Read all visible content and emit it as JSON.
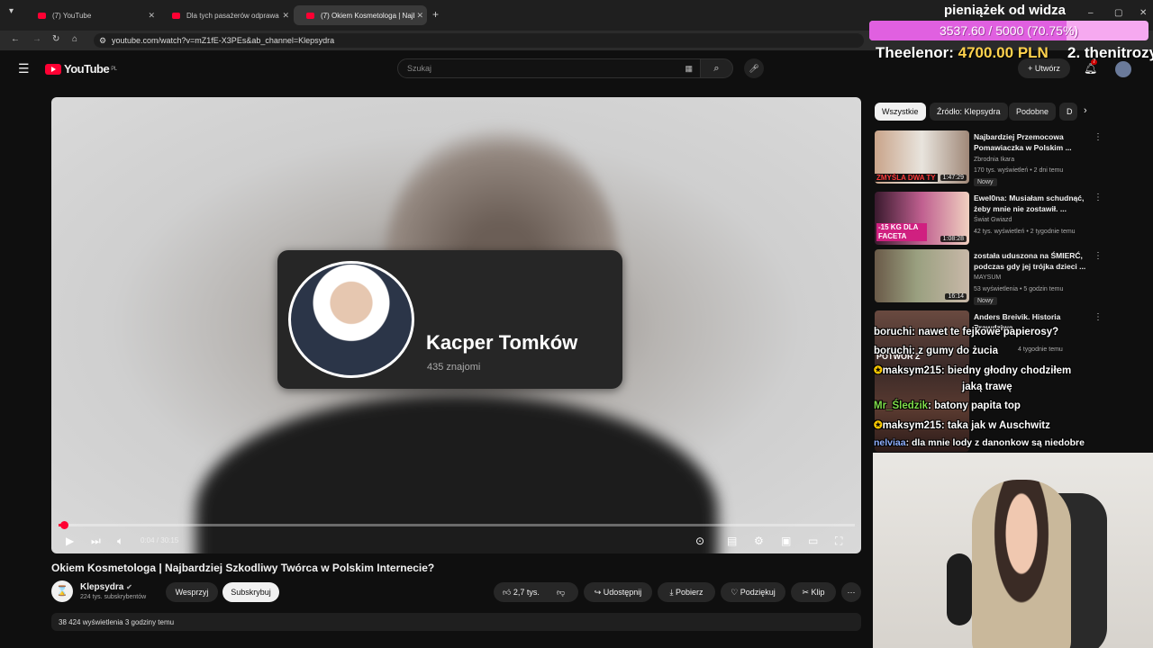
{
  "browser": {
    "tabs": [
      {
        "label": "(7) YouTube",
        "active": false
      },
      {
        "label": "Dla tych pasażerów odprawa s",
        "active": false
      },
      {
        "label": "(7) Okiem Kosmetologa | Najb",
        "active": true
      }
    ],
    "url": "youtube.com/watch?v=mZ1fE-X3PEs&ab_channel=Klepsydra"
  },
  "youtube": {
    "logo_text": "YouTube",
    "logo_region": "PL",
    "search_placeholder": "Szukaj",
    "create_label": "Utwórz",
    "notifications_count": "7"
  },
  "video": {
    "card_name": "Kacper Tomków",
    "card_friends": "435 znajomi",
    "time": "0:04 / 30:15",
    "progress_fraction": 0.0022,
    "title": "Okiem Kosmetologa | Najbardziej Szkodliwy Twórca w Polskim Internecie?",
    "channel_name": "Klepsydra",
    "channel_subs": "224 tys. subskrybentów",
    "support_label": "Wesprzyj",
    "subscribe_label": "Subskrybuj",
    "likes": "2,7 tys.",
    "share_label": "Udostępnij",
    "download_label": "Pobierz",
    "thanks_label": "Podziękuj",
    "clip_label": "Klip",
    "views": "38 424 wyświetlenia  3 godziny temu"
  },
  "sidebar": {
    "chips": [
      "Wszystkie",
      "Źródło: Klepsydra",
      "Podobne",
      "D"
    ],
    "recommendations": [
      {
        "title": "Najbardziej Przemocowa Pomawiaczka w Polskim ...",
        "channel": "Zbrodnia Ikara",
        "meta": "170 tys. wyświetleń • 2 dni temu",
        "duration": "1:47:29",
        "badge": "Nowy",
        "thumb_text": "ZMYŚLA DWA TY"
      },
      {
        "title": "Ewel0na: Musiałam schudnąć, żeby mnie nie zostawił. ...",
        "channel": "Świat Gwiazd",
        "meta": "42 tys. wyświetleń • 2 tygodnie temu",
        "duration": "1:08:28",
        "badge": "",
        "thumb_text": "-15 KG DLA FACETA"
      },
      {
        "title": "została uduszona na ŚMIERĆ, podczas gdy jej trójka dzieci ...",
        "channel": "MAYSUM",
        "meta": "53 wyświetlenia • 5 godzin temu",
        "duration": "16:14",
        "badge": "Nowy",
        "thumb_text": ""
      },
      {
        "title": "Anders Breivik. Historia Prawdziwa",
        "channel": "Zbrodnia Ikara",
        "meta": "4 tygodnie temu",
        "duration": "",
        "badge": "",
        "thumb_text": "POTWÓR Z"
      }
    ]
  },
  "chat": [
    {
      "user": "boruchi",
      "text": ": nawet te fejkowe papierosy?"
    },
    {
      "user": "boruchi",
      "text": ": z gumy do żucia"
    },
    {
      "user": "maksym215",
      "text": ": biedny głodny chodziłem"
    },
    {
      "user": "",
      "text": "jaką trawę"
    },
    {
      "user": "Mr_Śledzik",
      "text": ": batony papita top"
    },
    {
      "user": "maksym215",
      "text": ": taka jak w Auschwitz"
    },
    {
      "user": "nelviaa",
      "text": ": dla mnie lody z danonkow są niedobre"
    }
  ],
  "donation": {
    "title": "pieniążek od widza",
    "progress_text": "3537.60 / 5000 (70.75%)",
    "progress_fraction": 0.7075,
    "top_donor": "Theelenor:",
    "top_amount": "4700.00 PLN",
    "second_donor": "2. thenitrozy"
  },
  "colors": {
    "accent": "#ff0033",
    "background": "#0f0f0f",
    "donation_bar": "#f6a9f0"
  }
}
